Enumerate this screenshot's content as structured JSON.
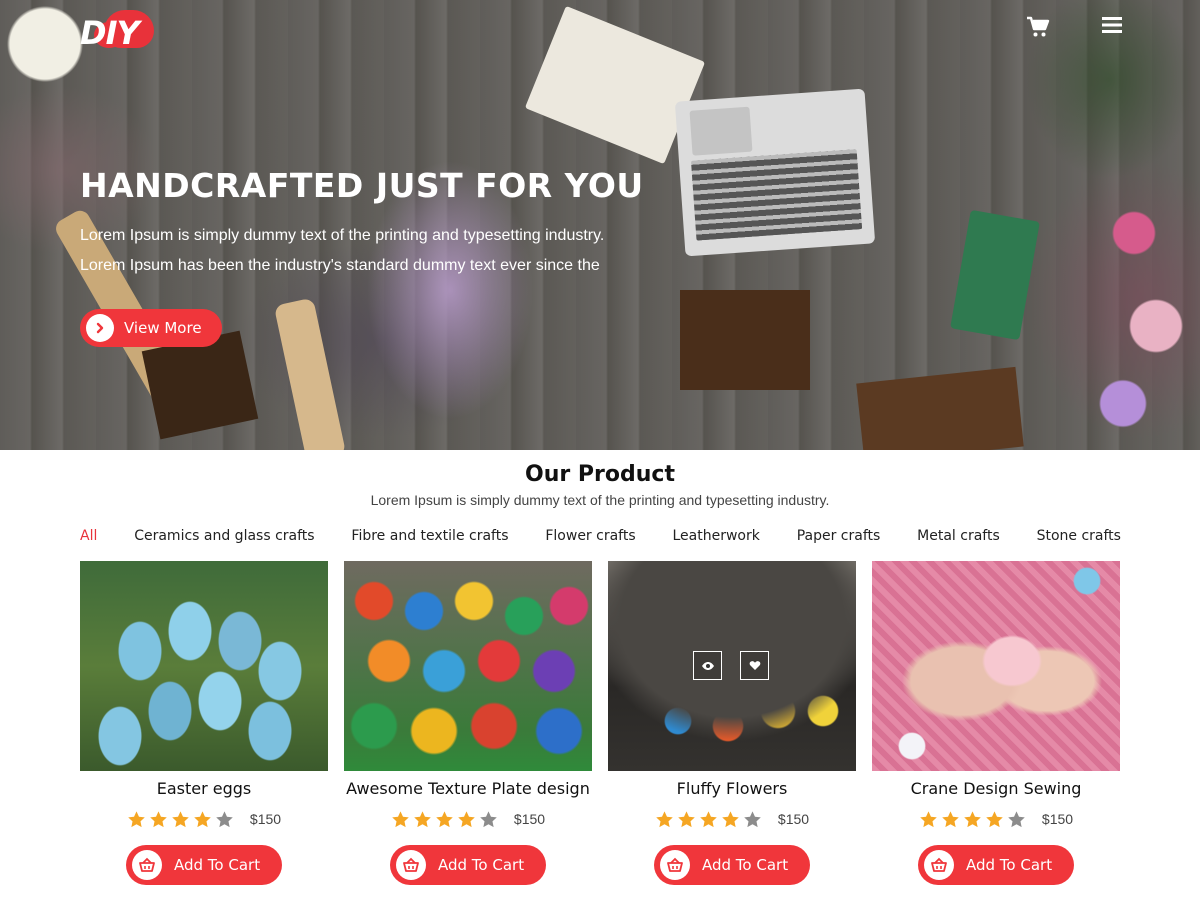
{
  "brand": {
    "logo_text": "DIY",
    "accent": "#f0363b"
  },
  "nav": {
    "icons": [
      "cart-icon",
      "menu-icon"
    ]
  },
  "hero": {
    "title": "HANDCRAFTED JUST FOR YOU",
    "line1": "Lorem Ipsum is simply dummy text of the printing and typesetting industry.",
    "line2": "Lorem Ipsum has been the industry's standard dummy text ever since the",
    "button_label": "View More"
  },
  "products_section": {
    "title": "Our Product",
    "subtitle": "Lorem Ipsum is simply dummy text of the printing and typesetting industry.",
    "tabs": [
      "All",
      "Ceramics and glass crafts",
      "Fibre and textile crafts",
      "Flower crafts",
      "Leatherwork",
      "Paper crafts",
      "Metal crafts",
      "Stone crafts"
    ],
    "active_tab": "All",
    "items": [
      {
        "name": "Easter eggs",
        "rating": 4,
        "max_rating": 5,
        "price": "$150",
        "button": "Add To Cart"
      },
      {
        "name": "Awesome Texture Plate design",
        "rating": 4,
        "max_rating": 5,
        "price": "$150",
        "button": "Add To Cart"
      },
      {
        "name": "Fluffy Flowers",
        "rating": 4,
        "max_rating": 5,
        "price": "$150",
        "button": "Add To Cart",
        "hover_icons": [
          "eye-icon",
          "heart-icon"
        ]
      },
      {
        "name": "Crane Design Sewing",
        "rating": 4,
        "max_rating": 5,
        "price": "$150",
        "button": "Add To Cart"
      }
    ]
  }
}
